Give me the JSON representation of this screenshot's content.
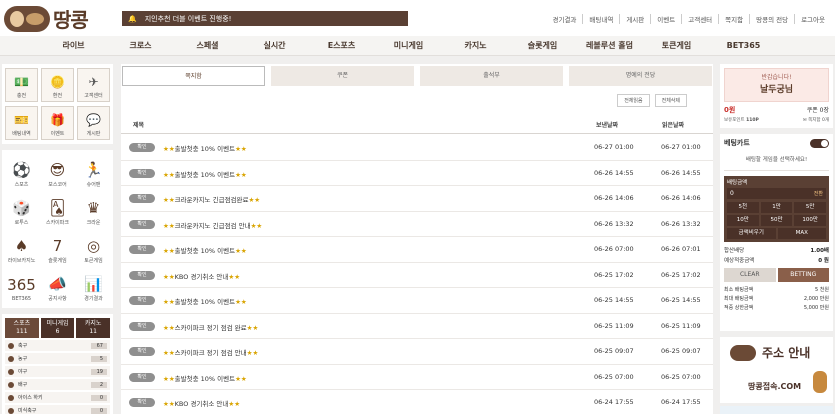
{
  "brand": {
    "name": "땅콩"
  },
  "notice": {
    "text": "지인추천 더블 이벤트 진행중!"
  },
  "toplinks": [
    "경기결과",
    "배팅내역",
    "게시판",
    "이벤트",
    "고객센터",
    "쪽지함",
    "땅콩의 전당",
    "로그아웃"
  ],
  "nav": [
    "라이브",
    "크로스",
    "스페셜",
    "실시간",
    "E스포츠",
    "미니게임",
    "카지노",
    "슬롯게임",
    "레볼루션 홀덤",
    "토큰게임",
    "BET365"
  ],
  "quick": [
    {
      "label": "충전",
      "icon": "money-icon"
    },
    {
      "label": "환전",
      "icon": "coin-icon"
    },
    {
      "label": "고객센터",
      "icon": "paper-plane-icon"
    },
    {
      "label": "배팅내역",
      "icon": "ticket-icon"
    },
    {
      "label": "이벤트",
      "icon": "gift-icon"
    },
    {
      "label": "게시판",
      "icon": "chat-icon"
    }
  ],
  "sports": [
    {
      "label": "스포츠",
      "icon": "ball-icon"
    },
    {
      "label": "보스코어",
      "icon": "sunglasses-icon"
    },
    {
      "label": "슈어맨",
      "icon": "runner-icon"
    },
    {
      "label": "로투스",
      "icon": "dice-icon"
    },
    {
      "label": "스카이파크",
      "icon": "cards-icon"
    },
    {
      "label": "크라운",
      "icon": "crown-icon"
    },
    {
      "label": "라이브카지노",
      "icon": "chip-icon"
    },
    {
      "label": "슬롯게임",
      "icon": "slot-icon"
    },
    {
      "label": "토큰게임",
      "icon": "token-icon"
    },
    {
      "label": "BET365",
      "icon": "bet365-icon"
    },
    {
      "label": "공지사항",
      "icon": "megaphone-icon"
    },
    {
      "label": "경기결과",
      "icon": "chart-icon"
    }
  ],
  "cat_tabs": [
    {
      "label": "스포츠",
      "count": "111"
    },
    {
      "label": "미니게임",
      "count": "6"
    },
    {
      "label": "카지노",
      "count": "11"
    }
  ],
  "cat_rows": [
    {
      "name": "축구",
      "count": "67"
    },
    {
      "name": "농구",
      "count": "5"
    },
    {
      "name": "야구",
      "count": "19"
    },
    {
      "name": "배구",
      "count": "2"
    },
    {
      "name": "아이스 하키",
      "count": "0"
    },
    {
      "name": "미식축구",
      "count": "0"
    }
  ],
  "board_tabs": [
    "쪽지함",
    "쿠폰",
    "출석부",
    "명예의 전당"
  ],
  "filters": [
    "전체읽음",
    "전체삭제"
  ],
  "columns": {
    "title": "제목",
    "sent": "보낸날짜",
    "read": "읽은날짜"
  },
  "badge_label": "확인",
  "messages": [
    {
      "title": "출발첫충 10% 이벤트",
      "stars": true,
      "sent": "06-27 01:00",
      "read": "06-27 01:00"
    },
    {
      "title": "출발첫충 10% 이벤트",
      "stars": true,
      "sent": "06-26 14:55",
      "read": "06-26 14:55"
    },
    {
      "title": "크라운카지노 긴급점검완료",
      "stars": true,
      "sent": "06-26 14:06",
      "read": "06-26 14:06"
    },
    {
      "title": "크라운카지노 긴급점검 안내",
      "stars": true,
      "sent": "06-26 13:32",
      "read": "06-26 13:32"
    },
    {
      "title": "출발첫충 10% 이벤트",
      "stars": true,
      "sent": "06-26 07:00",
      "read": "06-26 07:01"
    },
    {
      "title": "KBO 경기취소 안내",
      "stars": true,
      "sent": "06-25 17:02",
      "read": "06-25 17:02"
    },
    {
      "title": "출발첫충 10% 이벤트",
      "stars": true,
      "sent": "06-25 14:55",
      "read": "06-25 14:55"
    },
    {
      "title": "스카이파크 정기 점검 완료",
      "stars": true,
      "sent": "06-25 11:09",
      "read": "06-25 11:09"
    },
    {
      "title": "스카이파크 정기 점검 안내",
      "stars": true,
      "sent": "06-25 09:07",
      "read": "06-25 09:07"
    },
    {
      "title": "출발첫충 10% 이벤트",
      "stars": true,
      "sent": "06-25 07:00",
      "read": "06-25 07:00"
    },
    {
      "title": "KBO 경기취소 안내",
      "stars": true,
      "sent": "06-24 17:55",
      "read": "06-24 17:55"
    }
  ],
  "user": {
    "greeting": "반갑습니다!",
    "name": "날두궁님",
    "money": "0원",
    "coupon_label": "쿠폰",
    "coupon_value": "0장",
    "point_label": "보유포인트",
    "point_value": "110P",
    "msg_label": "쪽지함",
    "msg_value": "0개"
  },
  "betslip": {
    "title": "베팅카트",
    "message": "배팅할 게임을 선택하세요!",
    "amount_label": "배팅금액",
    "amount_value": "0",
    "confirm": "전환",
    "buttons": [
      "5천",
      "1만",
      "5만",
      "10만",
      "50만",
      "100만"
    ],
    "buttons2": [
      "금액비우기",
      "MAX"
    ],
    "odds_label": "합산배당",
    "odds_value": "1.00배",
    "win_label": "예상적중금액",
    "win_value": "0 원",
    "clear": "CLEAR",
    "betting": "BETTING",
    "min_label": "최소 배팅금액",
    "min_value": "5 천원",
    "max_label": "최대 배팅금액",
    "max_value": "2,000 만원",
    "maxwin_label": "적중 상한금액",
    "maxwin_value": "5,000 만원"
  },
  "banner": {
    "title": "주소 안내",
    "subtitle": "땅콩접속.COM"
  }
}
